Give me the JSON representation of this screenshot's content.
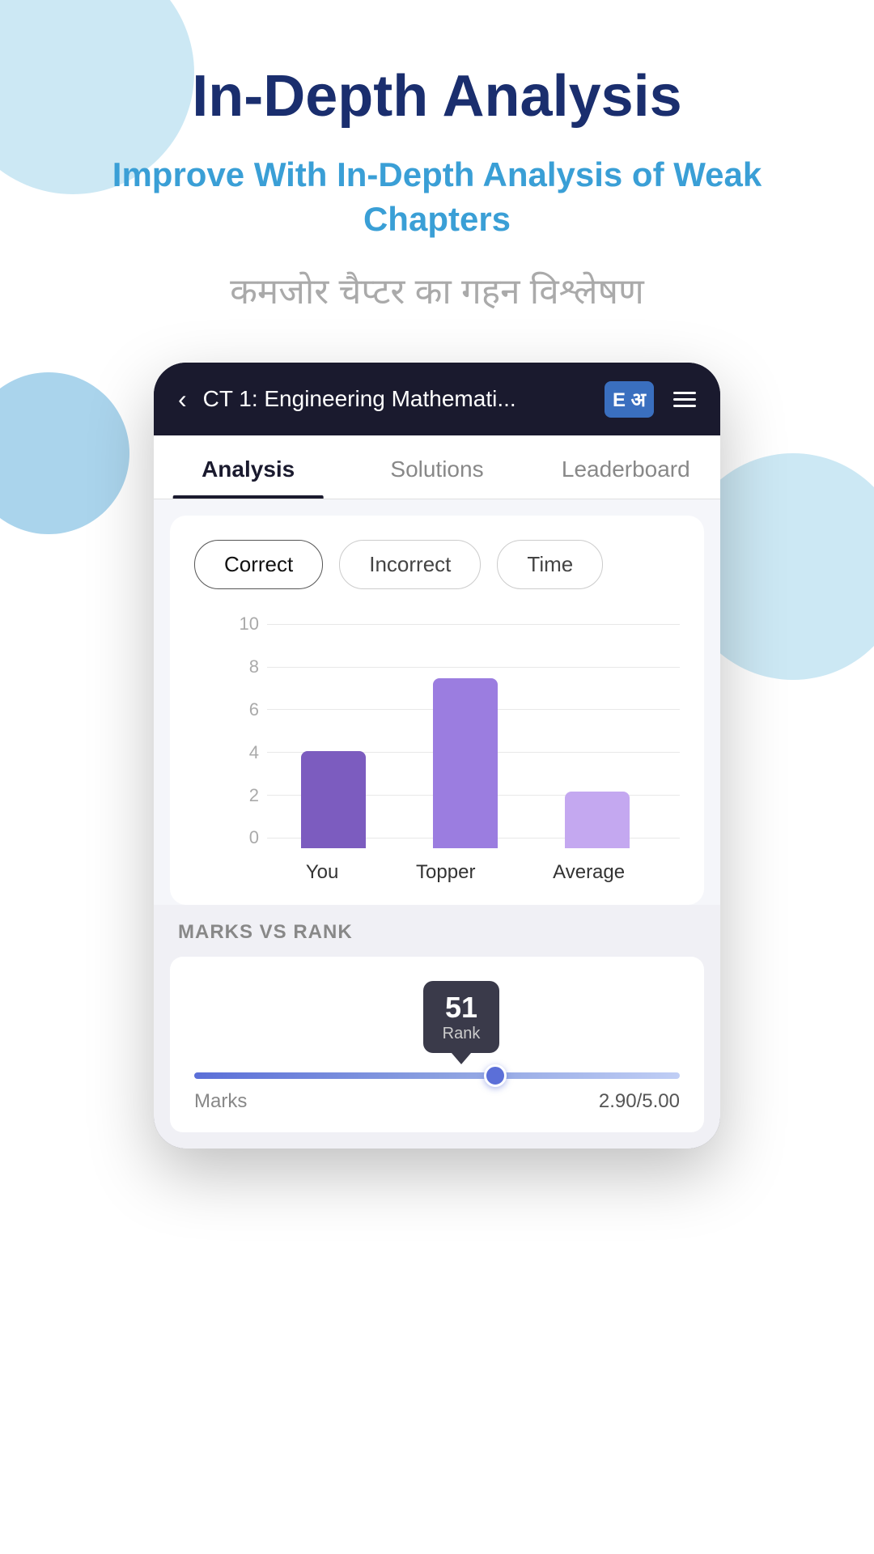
{
  "page": {
    "main_title": "In-Depth Analysis",
    "subtitle_en": "Improve With In-Depth Analysis of Weak Chapters",
    "subtitle_hi": "कमजोर चैप्टर का गहन विश्लेषण"
  },
  "phone": {
    "header": {
      "title": "CT 1: Engineering Mathemati...",
      "back_icon": "‹",
      "book_icon": "E अ",
      "menu_label": "menu"
    },
    "tabs": [
      {
        "label": "Analysis",
        "active": true
      },
      {
        "label": "Solutions",
        "active": false
      },
      {
        "label": "Leaderboard",
        "active": false
      }
    ],
    "filter_buttons": [
      {
        "label": "Correct",
        "active": true
      },
      {
        "label": "Incorrect",
        "active": false
      },
      {
        "label": "Time",
        "active": false
      }
    ],
    "chart": {
      "y_labels": [
        "10",
        "8",
        "6",
        "4",
        "2",
        "0"
      ],
      "bars": [
        {
          "label": "You",
          "height_pct": 40
        },
        {
          "label": "Topper",
          "height_pct": 70
        },
        {
          "label": "Average",
          "height_pct": 23
        }
      ]
    },
    "marks_rank": {
      "section_title": "MARKS VS RANK",
      "rank_number": "51",
      "rank_label": "Rank",
      "slider_position_pct": 62,
      "marks_label": "Marks",
      "marks_value": "2.90/5.00"
    }
  }
}
